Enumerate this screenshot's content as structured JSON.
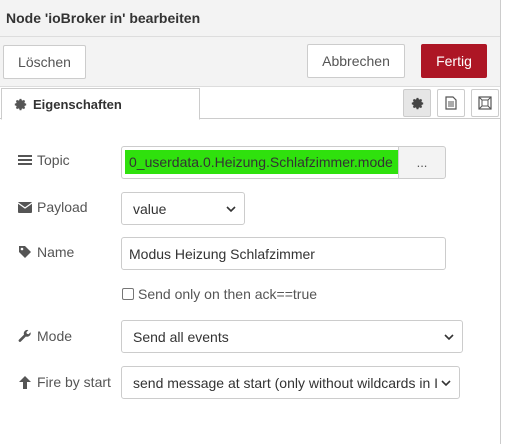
{
  "window": {
    "title": "Node 'ioBroker in' bearbeiten"
  },
  "toolbar": {
    "delete_label": "Löschen",
    "cancel_label": "Abbrechen",
    "done_label": "Fertig"
  },
  "colors": {
    "accent": "#ad1625",
    "highlight": "#2fe10d"
  },
  "tabs": [
    {
      "label": "Eigenschaften",
      "icon": "gear-icon"
    }
  ],
  "tab_tools": [
    {
      "icon": "gear-icon"
    },
    {
      "icon": "document-icon"
    },
    {
      "icon": "appearance-icon"
    }
  ],
  "form": {
    "topic": {
      "label": "Topic",
      "icon": "list-icon",
      "value": "0_userdata.0.Heizung.Schlafzimmer.mode",
      "button_label": "..."
    },
    "payload": {
      "label": "Payload",
      "icon": "envelope-icon",
      "selected": "value"
    },
    "name": {
      "label": "Name",
      "icon": "tag-icon",
      "value": "Modus Heizung Schlafzimmer"
    },
    "ack": {
      "label": "Send only on then ack==true",
      "checked": false
    },
    "mode": {
      "label": "Mode",
      "icon": "wrench-icon",
      "selected": "Send all events"
    },
    "fire": {
      "label": "Fire by start",
      "icon": "arrow-up-icon",
      "selected": "send message at start (only without wildcards in I"
    }
  }
}
